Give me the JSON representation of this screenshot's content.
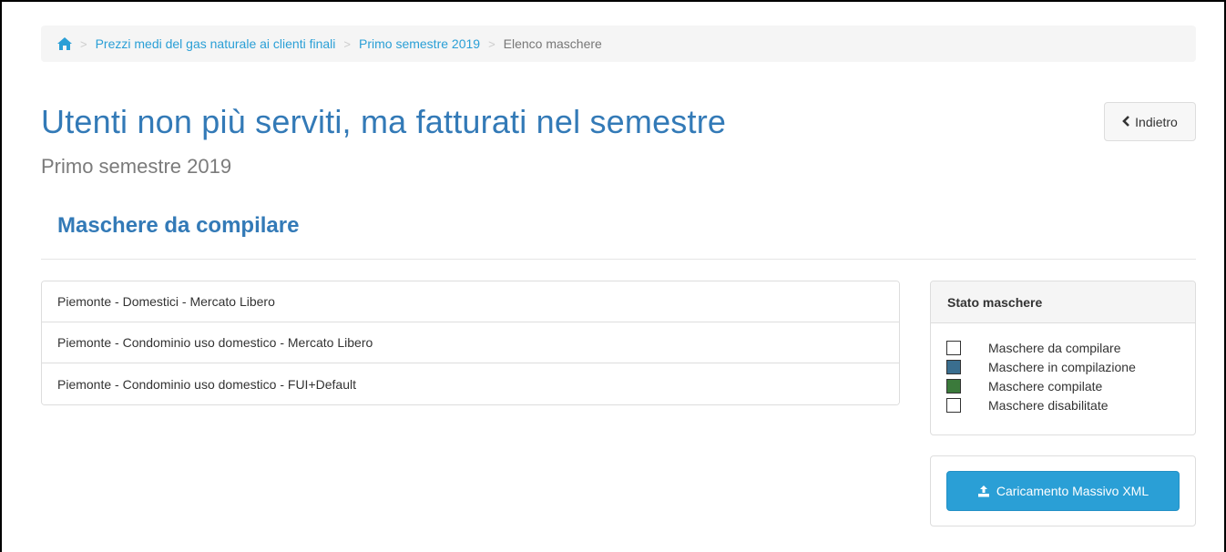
{
  "breadcrumb": {
    "home_icon": "home-icon",
    "separator": ">",
    "items": [
      {
        "label": "Prezzi medi del gas naturale ai clienti finali",
        "link": true
      },
      {
        "label": "Primo semestre 2019",
        "link": true
      },
      {
        "label": "Elenco maschere",
        "link": false
      }
    ]
  },
  "header": {
    "title": "Utenti non più serviti, ma fatturati nel semestre",
    "subtitle": "Primo semestre 2019",
    "back_label": "Indietro",
    "back_icon": "chevron-left-icon"
  },
  "section": {
    "title": "Maschere da compilare"
  },
  "masks": [
    {
      "label": "Piemonte - Domestici - Mercato Libero"
    },
    {
      "label": "Piemonte - Condominio uso domestico - Mercato Libero"
    },
    {
      "label": "Piemonte - Condominio uso domestico - FUI+Default"
    }
  ],
  "status_panel": {
    "title": "Stato maschere",
    "legend": [
      {
        "label": "Maschere da compilare",
        "color": "#ffffff"
      },
      {
        "label": "Maschere in compilazione",
        "color": "#3a6e8f"
      },
      {
        "label": "Maschere compilate",
        "color": "#3b7a3b"
      },
      {
        "label": "Maschere disabilitate",
        "color": "#ffffff"
      }
    ]
  },
  "upload": {
    "label": "Caricamento Massivo XML",
    "icon": "upload-icon"
  },
  "colors": {
    "accent": "#2a9fd6",
    "title": "#337ab7"
  }
}
